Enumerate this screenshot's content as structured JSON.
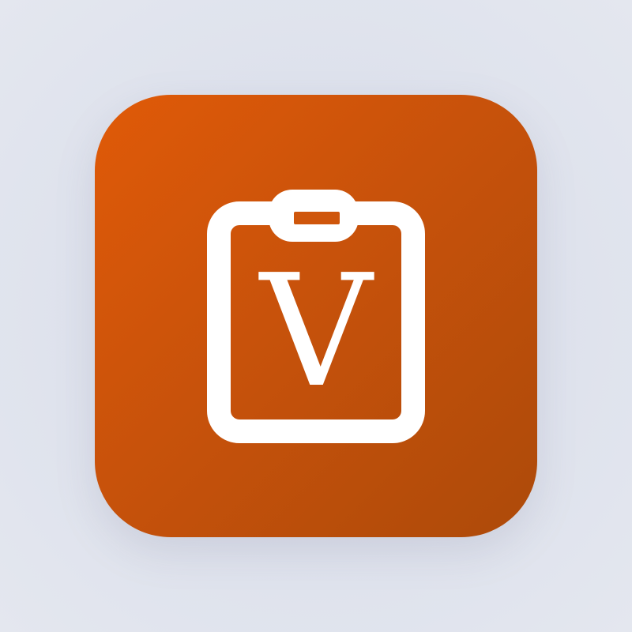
{
  "app_icon": {
    "icon": "clipboard-icon",
    "letter": "V",
    "colors": {
      "background_start": "#e05a08",
      "background_end": "#ad4a0a",
      "glyph": "#ffffff",
      "page_background": "#dde1ec"
    }
  }
}
